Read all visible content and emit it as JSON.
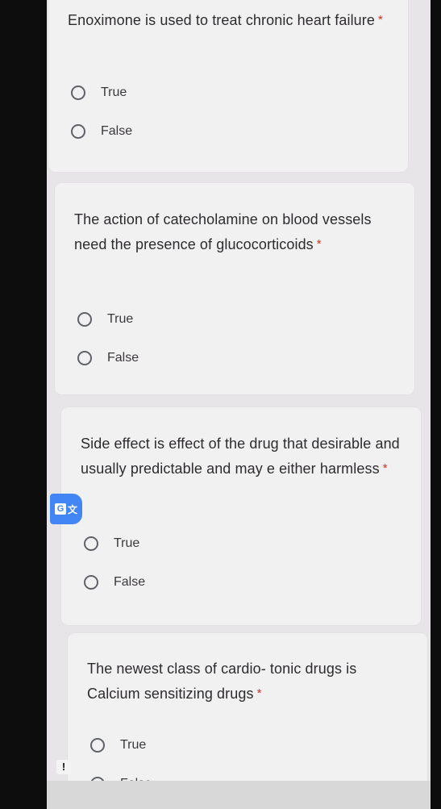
{
  "required_mark": "*",
  "questions": [
    {
      "text": "Enoximone is used to treat chronic heart failure",
      "options": [
        "True",
        "False"
      ]
    },
    {
      "text": "The action of catecholamine on blood vessels need the presence of glucocorticoids",
      "options": [
        "True",
        "False"
      ]
    },
    {
      "text": "Side effect is effect of the drug that desirable and usually predictable and may e either harmless",
      "options": [
        "True",
        "False"
      ]
    },
    {
      "text": "The newest class of cardio- tonic drugs is Calcium sensitizing drugs",
      "options": [
        "True",
        "False"
      ]
    }
  ],
  "overlay": {
    "translate_letter": "G",
    "translate_glyph": "文",
    "warning_glyph": "!"
  }
}
